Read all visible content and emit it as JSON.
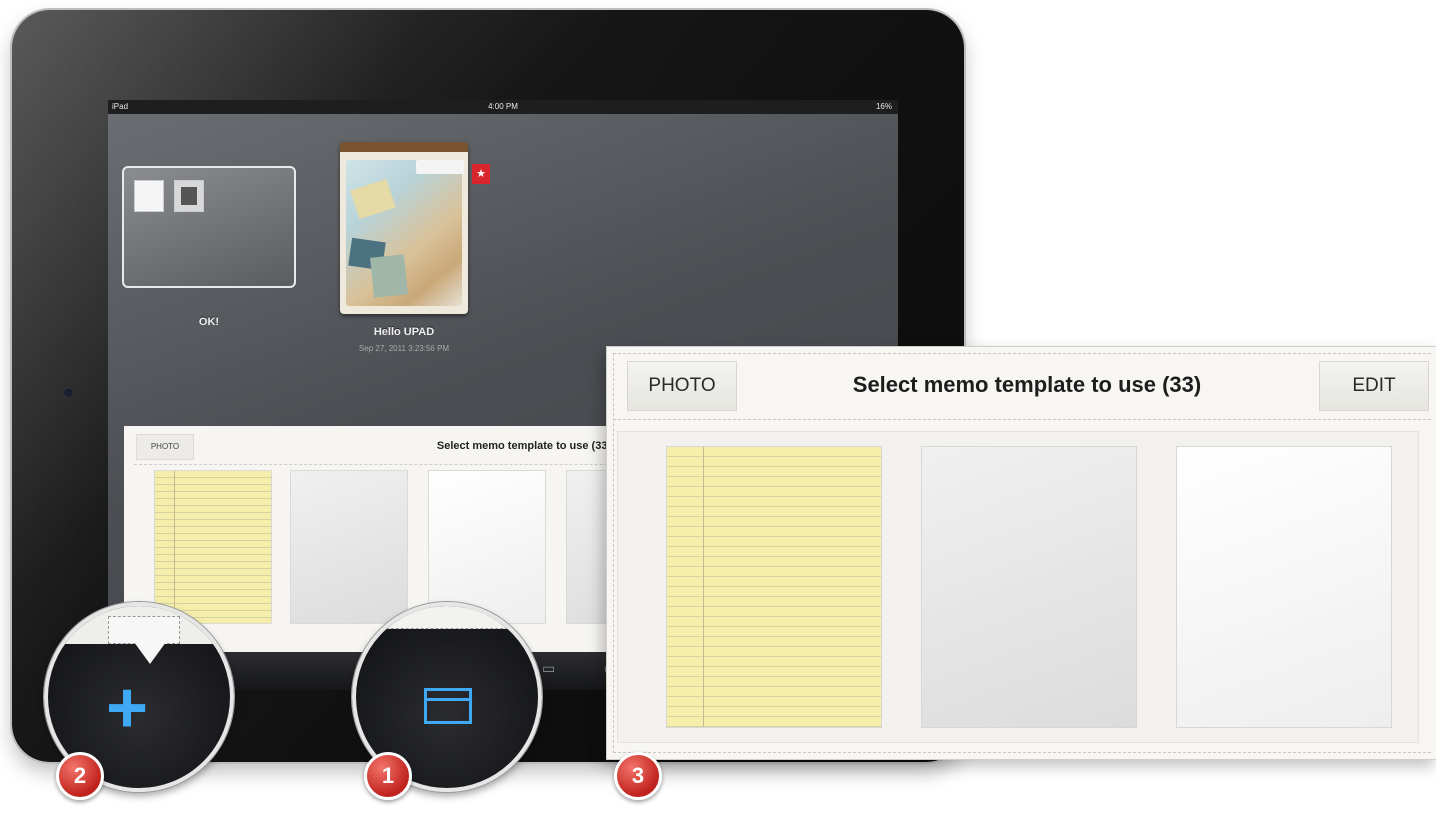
{
  "statusbar": {
    "carrier": "iPad",
    "time": "4:00 PM",
    "battery": "16%"
  },
  "memos": [
    {
      "title": "OK!"
    },
    {
      "title": "Hello UPAD",
      "date": "Sep 27, 2011 3:23:56 PM",
      "favorite": true
    }
  ],
  "template_panel_small": {
    "photo_button": "PHOTO",
    "title": "Select memo template to use (33)"
  },
  "template_panel_large": {
    "photo_button": "PHOTO",
    "title": "Select memo template to use (33)",
    "edit_button": "EDIT",
    "templates": [
      "yellow-legal-pad",
      "gray-paper",
      "white-paper"
    ]
  },
  "toolbar": {
    "icons": [
      "plus-icon",
      "window-icon"
    ],
    "accent_color": "#3fa9f5"
  },
  "steps": {
    "one": "1",
    "two": "2",
    "three": "3"
  },
  "colors": {
    "badge": "#d0302a",
    "accent": "#3fa9f5",
    "legal_pad": "#f4eeaa"
  }
}
